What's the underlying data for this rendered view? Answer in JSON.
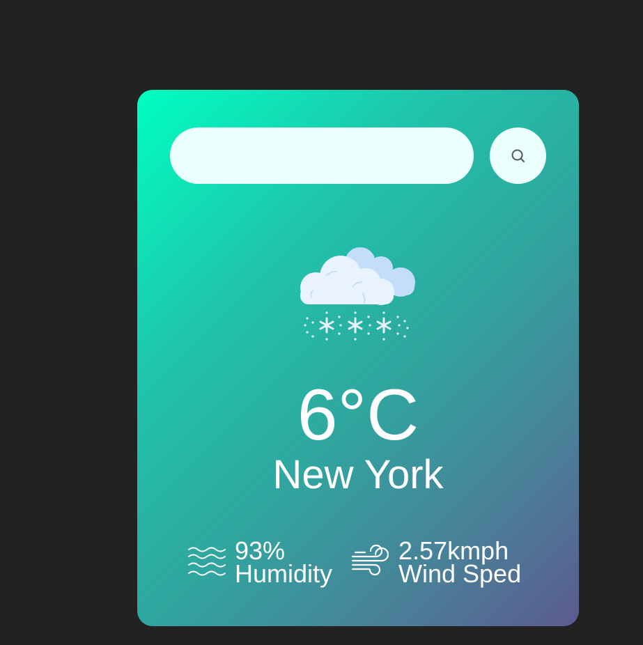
{
  "search": {
    "value": "",
    "placeholder": "",
    "button_icon": "search-icon"
  },
  "weather": {
    "icon": "snow-cloud-icon",
    "temperature": "6°C",
    "city": "New York"
  },
  "details": {
    "humidity": {
      "icon": "humidity-waves-icon",
      "value": "93%",
      "label": "Humidity"
    },
    "wind": {
      "icon": "wind-icon",
      "value": "2.57kmph",
      "label": "Wind Sped"
    }
  },
  "colors": {
    "page_background": "#222222",
    "card_gradient_start": "#00ffc0",
    "card_gradient_end": "#5c5a90",
    "input_background": "#ebfffc",
    "text": "#ffffff"
  }
}
